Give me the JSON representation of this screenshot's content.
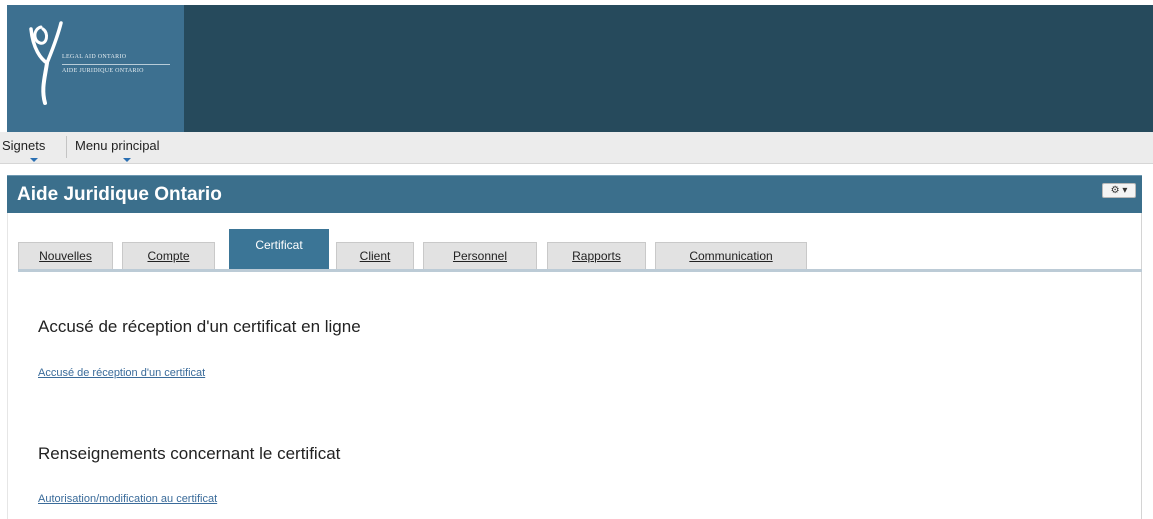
{
  "header": {
    "logo_line1": "Legal Aid Ontario",
    "logo_line2": "Aide juridique Ontario",
    "colors": {
      "band": "#264a5c",
      "logo_box": "#3d7090"
    }
  },
  "menubar": {
    "bookmarks_label": "Signets",
    "main_menu_label": "Menu principal"
  },
  "titlebar": {
    "title": "Aide Juridique Ontario",
    "settings_icon": "gear-icon"
  },
  "tabs": [
    {
      "label": "Nouvelles",
      "active": false
    },
    {
      "label": "Compte",
      "active": false
    },
    {
      "label": "Certificat",
      "active": true
    },
    {
      "label": "Client",
      "active": false
    },
    {
      "label": "Personnel",
      "active": false
    },
    {
      "label": "Rapports",
      "active": false
    },
    {
      "label": "Communication",
      "active": false
    }
  ],
  "sections": [
    {
      "title": "Accusé de réception d'un certificat en ligne",
      "link": "Accusé de réception d'un certificat"
    },
    {
      "title": "Renseignements concernant le certificat",
      "link": "Autorisation/modification au certificat"
    }
  ],
  "colors": {
    "accent": "#3b7596",
    "link": "#3a6b9a"
  }
}
